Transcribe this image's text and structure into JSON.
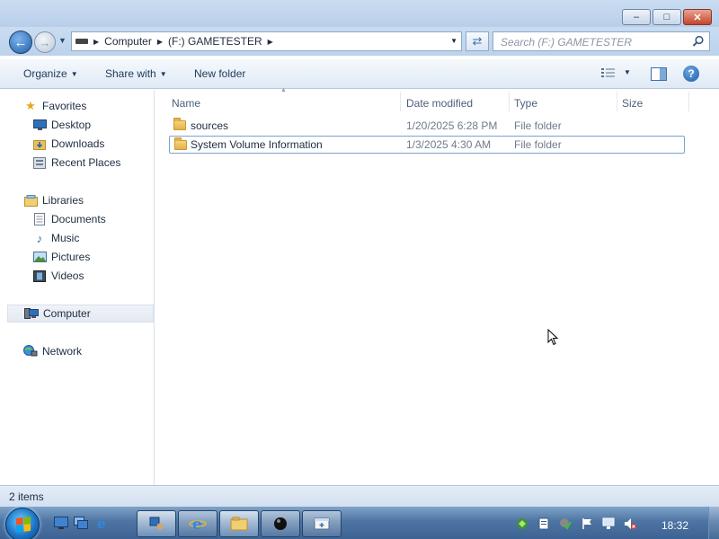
{
  "window": {
    "min_icon": "minimize-icon",
    "max_icon": "maximize-icon",
    "close_icon": "close-icon"
  },
  "address": {
    "crumbs": [
      "Computer",
      "(F:) GAMETESTER"
    ],
    "search_placeholder": "Search (F:) GAMETESTER"
  },
  "commands": {
    "organize": "Organize",
    "share": "Share with",
    "new_folder": "New folder"
  },
  "navpane": {
    "favorites": "Favorites",
    "desktop": "Desktop",
    "downloads": "Downloads",
    "recent": "Recent Places",
    "libraries": "Libraries",
    "documents": "Documents",
    "music": "Music",
    "pictures": "Pictures",
    "videos": "Videos",
    "computer": "Computer",
    "network": "Network"
  },
  "columns": {
    "name": "Name",
    "date": "Date modified",
    "type": "Type",
    "size": "Size"
  },
  "files": [
    {
      "name": "sources",
      "date": "1/20/2025 6:28 PM",
      "type": "File folder",
      "size": ""
    },
    {
      "name": "System Volume Information",
      "date": "1/3/2025 4:30 AM",
      "type": "File folder",
      "size": ""
    }
  ],
  "status": {
    "items": "2 items"
  },
  "taskbar": {
    "time": "18:32"
  },
  "colors": {
    "accent": "#1d5aa4",
    "taskbar": "#4d74a2"
  }
}
